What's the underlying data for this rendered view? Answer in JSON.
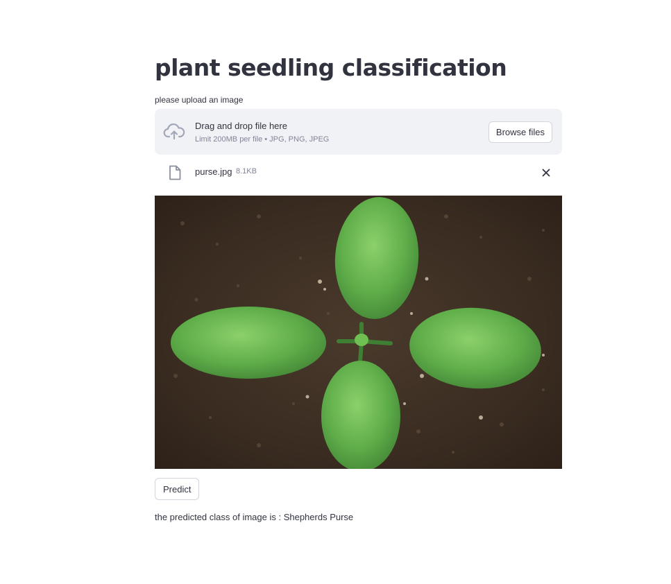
{
  "app": {
    "title": "plant seedling classification"
  },
  "uploader": {
    "label": "please upload an image",
    "drop_text": "Drag and drop file here",
    "limit_text": "Limit 200MB per file • JPG, PNG, JPEG",
    "browse_label": "Browse files",
    "icon": "cloud-upload-icon"
  },
  "uploaded_file": {
    "name": "purse.jpg",
    "size": "8.1KB",
    "icon": "file-icon",
    "remove_icon": "close-icon"
  },
  "image": {
    "subject": "plant seedling on soil"
  },
  "actions": {
    "predict_label": "Predict"
  },
  "result": {
    "text": "the predicted class of image is : Shepherds Purse"
  },
  "colors": {
    "text": "#31333f",
    "muted": "#808495",
    "dropzone_bg": "#f0f2f6",
    "border": "#d3d5dc",
    "leaf": "#5fae4a",
    "soil": "#3a2c22"
  }
}
